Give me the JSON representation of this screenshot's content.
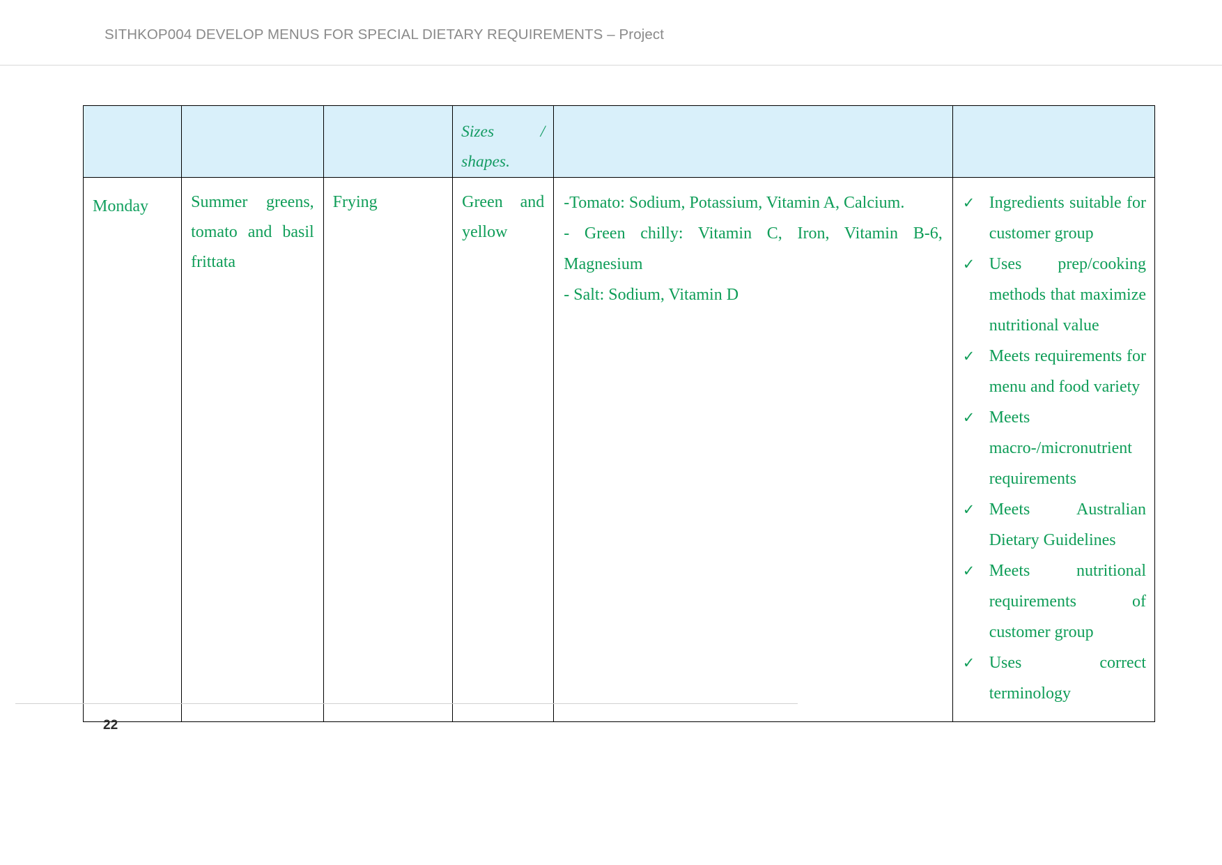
{
  "header": {
    "title": "SITHKOP004 DEVELOP MENUS FOR SPECIAL DIETARY REQUIREMENTS – Project"
  },
  "footer": {
    "page_number": "22"
  },
  "colors": {
    "header_row_background": "#d9f0fa",
    "body_text_green": "#0f9d58",
    "header_text_grey": "#8a8a8a",
    "table_border": "#000000"
  },
  "table": {
    "header_row": {
      "col1": "",
      "col2": "",
      "col3": "",
      "col4_line1": "Sizes              /",
      "col4_line2": "shapes.",
      "col5": "",
      "col6": ""
    },
    "rows": [
      {
        "day": "Monday",
        "dish": "Summer greens, tomato and basil frittata",
        "cooking_method": "Frying",
        "sizes_shapes": "Green and yellow",
        "nutrients": [
          "-Tomato: Sodium, Potassium, Vitamin A, Calcium.",
          "- Green chilly: Vitamin C, Iron, Vitamin B-6, Magnesium",
          "- Salt: Sodium, Vitamin D"
        ],
        "checklist": [
          "Ingredients suitable for customer group",
          "Uses prep/cooking methods that maximize nutritional value",
          "Meets requirements for menu and food variety",
          "Meets macro-/micronutrient requirements",
          "Meets Australian Dietary Guidelines",
          "Meets nutritional requirements of customer group",
          "Uses correct terminology"
        ],
        "check_glyph": "✓"
      }
    ]
  }
}
